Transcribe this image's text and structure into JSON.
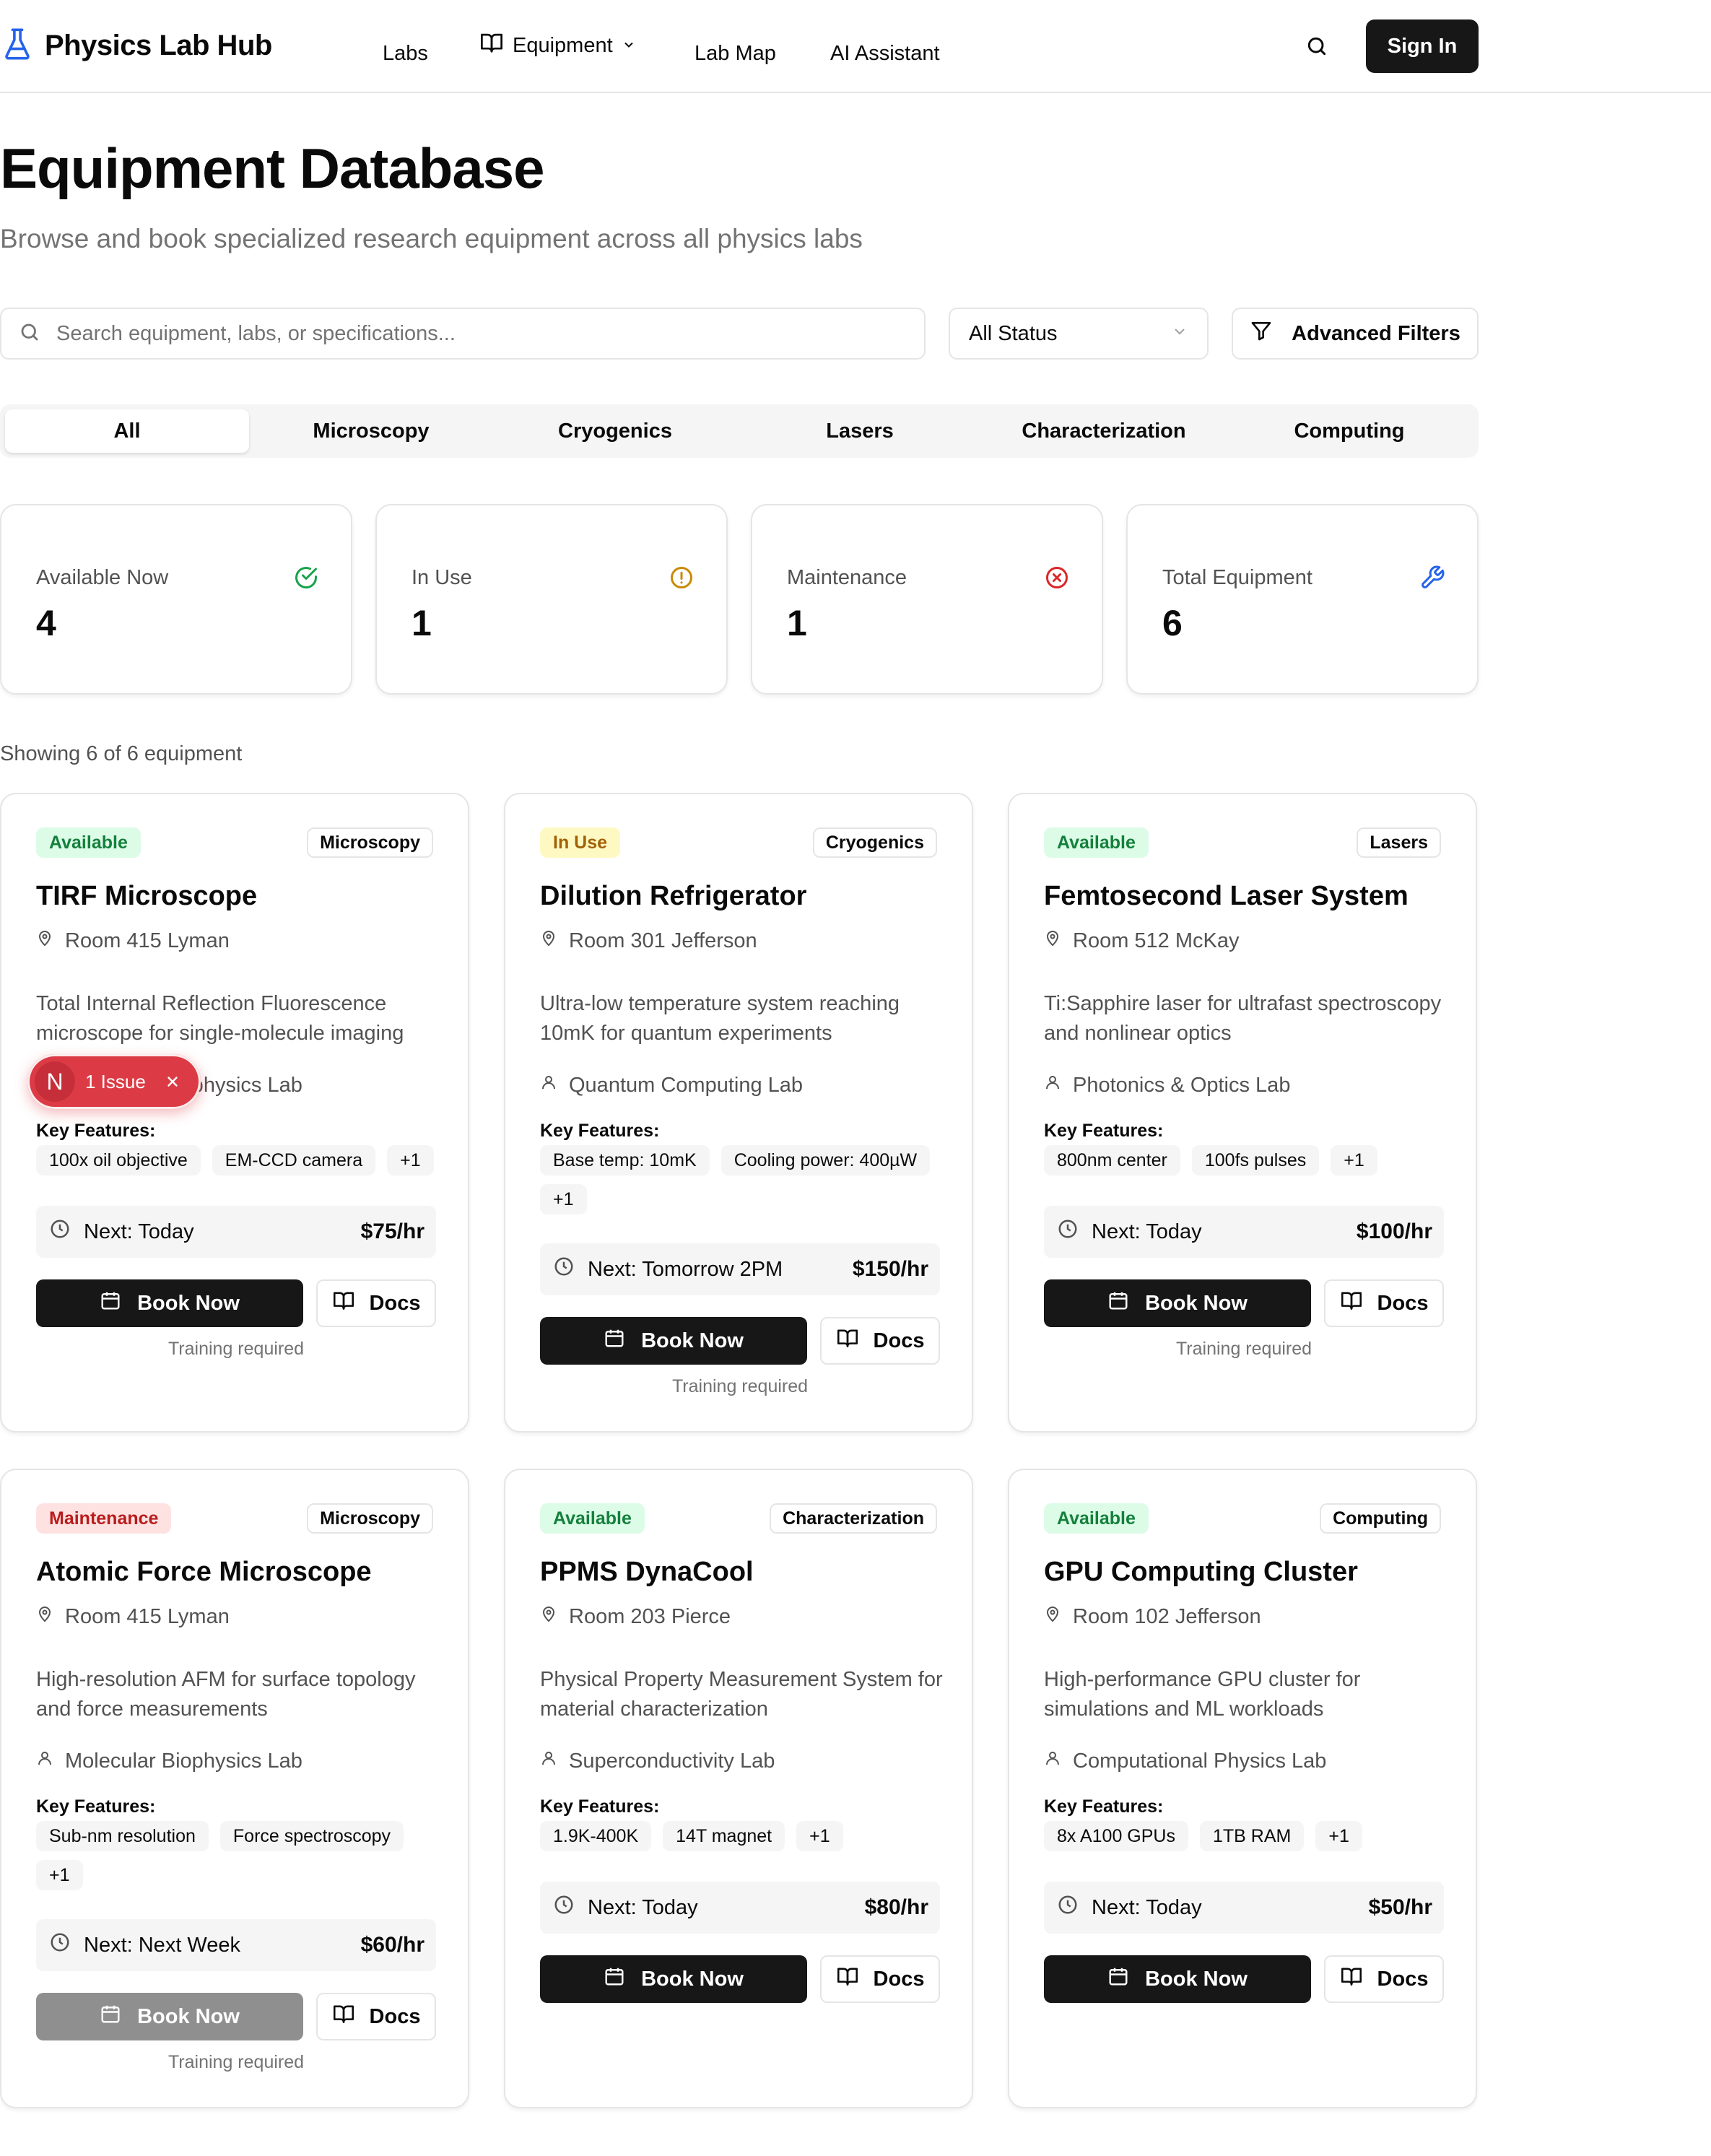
{
  "brand": {
    "title": "Physics Lab Hub",
    "accent": "#2563eb"
  },
  "nav": {
    "labs": "Labs",
    "equipment": "Equipment",
    "lab_map": "Lab Map",
    "ai_assistant": "AI Assistant"
  },
  "header": {
    "sign_in": "Sign In"
  },
  "page": {
    "title": "Equipment Database",
    "subtitle": "Browse and book specialized research equipment across all physics labs"
  },
  "filters": {
    "search_placeholder": "Search equipment, labs, or specifications...",
    "status_value": "All Status",
    "advanced": "Advanced Filters"
  },
  "tabs": [
    "All",
    "Microscopy",
    "Cryogenics",
    "Lasers",
    "Characterization",
    "Computing"
  ],
  "stats": [
    {
      "label": "Available Now",
      "value": "4",
      "icon": "check-circle-icon",
      "color": "#16a34a"
    },
    {
      "label": "In Use",
      "value": "1",
      "icon": "alert-circle-icon",
      "color": "#ca8a04"
    },
    {
      "label": "Maintenance",
      "value": "1",
      "icon": "x-circle-icon",
      "color": "#dc2626"
    },
    {
      "label": "Total Equipment",
      "value": "6",
      "icon": "wrench-icon",
      "color": "#2563eb"
    }
  ],
  "showing": "Showing 6 of 6 equipment",
  "labels": {
    "key_features": "Key Features:",
    "book_now": "Book Now",
    "docs": "Docs"
  },
  "equipment": [
    {
      "status": "Available",
      "category": "Microscopy",
      "name": "TIRF Microscope",
      "room": "Room 415 Lyman",
      "description": "Total Internal Reflection Fluorescence microscope for single-molecule imaging",
      "lab": "Molecular Biophysics Lab",
      "features": [
        "100x oil objective",
        "EM-CCD camera",
        "+1"
      ],
      "next": "Next: Today",
      "price": "$75/hr",
      "training": "Training required"
    },
    {
      "status": "In Use",
      "category": "Cryogenics",
      "name": "Dilution Refrigerator",
      "room": "Room 301 Jefferson",
      "description": "Ultra-low temperature system reaching 10mK for quantum experiments",
      "lab": "Quantum Computing Lab",
      "features": [
        "Base temp: 10mK",
        "Cooling power: 400µW",
        "+1"
      ],
      "next": "Next: Tomorrow 2PM",
      "price": "$150/hr",
      "training": "Training required"
    },
    {
      "status": "Available",
      "category": "Lasers",
      "name": "Femtosecond Laser System",
      "room": "Room 512 McKay",
      "description": "Ti:Sapphire laser for ultrafast spectroscopy and nonlinear optics",
      "lab": "Photonics & Optics Lab",
      "features": [
        "800nm center",
        "100fs pulses",
        "+1"
      ],
      "next": "Next: Today",
      "price": "$100/hr",
      "training": "Training required"
    },
    {
      "status": "Maintenance",
      "category": "Microscopy",
      "name": "Atomic Force Microscope",
      "room": "Room 415 Lyman",
      "description": "High-resolution AFM for surface topology and force measurements",
      "lab": "Molecular Biophysics Lab",
      "features": [
        "Sub-nm resolution",
        "Force spectroscopy",
        "+1"
      ],
      "next": "Next: Next Week",
      "price": "$60/hr",
      "training": "Training required"
    },
    {
      "status": "Available",
      "category": "Characterization",
      "name": "PPMS DynaCool",
      "room": "Room 203 Pierce",
      "description": "Physical Property Measurement System for material characterization",
      "lab": "Superconductivity Lab",
      "features": [
        "1.9K-400K",
        "14T magnet",
        "+1"
      ],
      "next": "Next: Today",
      "price": "$80/hr",
      "training": ""
    },
    {
      "status": "Available",
      "category": "Computing",
      "name": "GPU Computing Cluster",
      "room": "Room 102 Jefferson",
      "description": "High-performance GPU cluster for simulations and ML workloads",
      "lab": "Computational Physics Lab",
      "features": [
        "8x A100 GPUs",
        "1TB RAM",
        "+1"
      ],
      "next": "Next: Today",
      "price": "$50/hr",
      "training": ""
    }
  ],
  "issue_overlay": {
    "letter": "N",
    "text": "1 Issue"
  }
}
